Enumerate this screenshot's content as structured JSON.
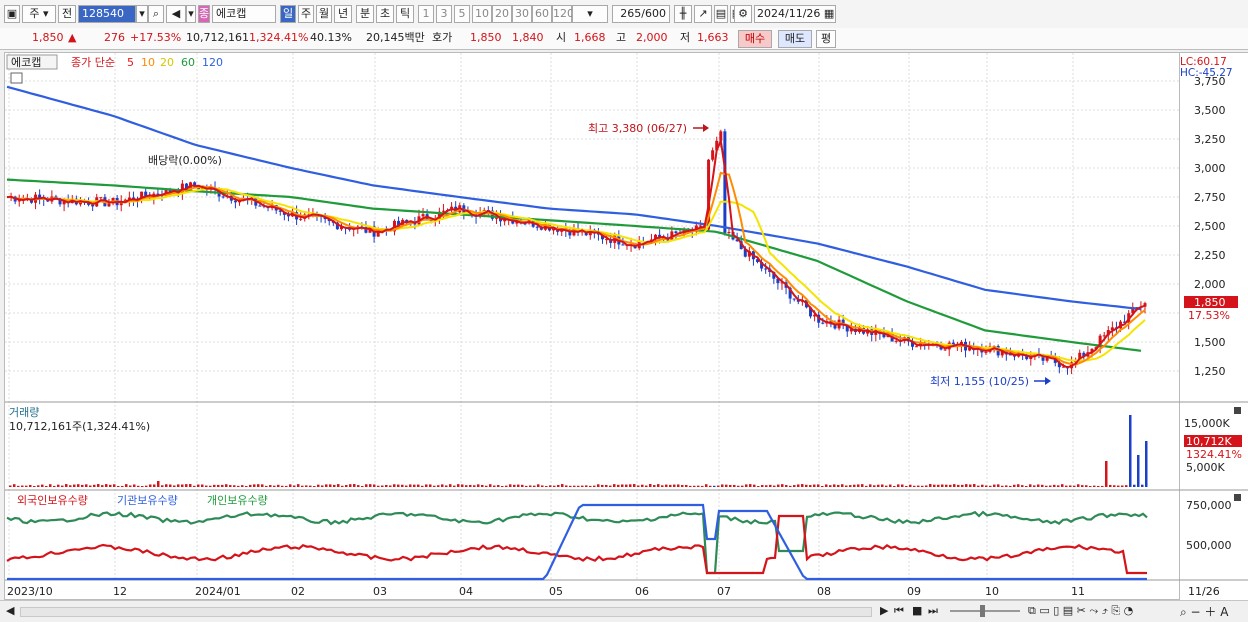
{
  "toolbar": {
    "period": "주",
    "prev": "전",
    "code": "128540",
    "stock_name": "에코캡",
    "timeframes": [
      "일",
      "주",
      "월",
      "년",
      "분",
      "초",
      "틱"
    ],
    "intervals": [
      "1",
      "3",
      "5",
      "10",
      "20",
      "30",
      "60",
      "120"
    ],
    "count": "265",
    "count_total": "/600",
    "date": "2024/11/26"
  },
  "quote": {
    "price": "1,850",
    "change": "276",
    "change_pct": "+17.53%",
    "volume": "10,712,161",
    "volume_pct": "1,324.41%",
    "turnover": "40.13%",
    "amount": "20,145백만",
    "ask_label": "호가",
    "ask": "1,850",
    "bid": "1,840",
    "open_label": "시",
    "open": "1,668",
    "high_label": "고",
    "high": "2,000",
    "low_label": "저",
    "low": "1,663",
    "buy": "매수",
    "sell": "매도",
    "eval": "평"
  },
  "price_panel": {
    "name": "에코캡",
    "legend_prefix": "종가 단순",
    "ma_legend": [
      {
        "label": "5",
        "color": "#e31a1c"
      },
      {
        "label": "10",
        "color": "#ff8c00"
      },
      {
        "label": "20",
        "color": "#f2e000"
      },
      {
        "label": "60",
        "color": "#1f9b3a"
      },
      {
        "label": "120",
        "color": "#2f5fe0"
      }
    ],
    "lc": "LC:60.17",
    "hc": "HC:-45.27",
    "high_note": "최고 3,380 (06/27)",
    "low_note": "최저 1,155 (10/25)",
    "dividend_note": "배당락(0.00%)",
    "price_tag": "1,850",
    "pct_tag": "17.53%",
    "y_ticks": [
      "3,750",
      "3,500",
      "3,250",
      "3,000",
      "2,750",
      "2,500",
      "2,250",
      "2,000",
      "1,750",
      "1,500",
      "1,250"
    ]
  },
  "volume_panel": {
    "title": "거래량",
    "info": "10,712,161주(1,324.41%)",
    "y_ticks": [
      "15,000K",
      "10,000K",
      "5,000K"
    ],
    "tag1": "10,712K",
    "tag2": "1324.41%"
  },
  "holding_panel": {
    "foreign": "외국인보유수량",
    "inst": "기관보유수량",
    "indiv": "개인보유수량",
    "y_ticks": [
      "750,000",
      "500,000"
    ]
  },
  "x_axis": [
    "2023/10",
    "12",
    "2024/01",
    "02",
    "03",
    "04",
    "05",
    "06",
    "07",
    "08",
    "09",
    "10",
    "11",
    "11/26"
  ],
  "chart_data": {
    "type": "line",
    "title": "에코캡",
    "ylabel": "",
    "xlabel": "",
    "x": [
      "2023/10",
      "12",
      "2024/01",
      "02",
      "03",
      "04",
      "05",
      "06",
      "07",
      "08",
      "09",
      "10",
      "11",
      "11/26"
    ],
    "ylim": [
      1100,
      3800
    ],
    "series": [
      {
        "name": "종가",
        "values": [
          2750,
          2700,
          2850,
          2600,
          2450,
          2650,
          2500,
          2350,
          2500,
          1700,
          1500,
          1450,
          1300,
          1850
        ]
      },
      {
        "name": "60",
        "values": [
          2900,
          2850,
          2800,
          2750,
          2650,
          2600,
          2550,
          2500,
          2450,
          2200,
          1850,
          1600,
          1500,
          1420
        ]
      },
      {
        "name": "120",
        "values": [
          3700,
          3450,
          3200,
          3000,
          2850,
          2750,
          2650,
          2600,
          2500,
          2350,
          2150,
          1950,
          1850,
          1780
        ]
      }
    ],
    "annotations": [
      "최고 3,380 (06/27)",
      "최저 1,155 (10/25)",
      "배당락(0.00%)"
    ]
  }
}
